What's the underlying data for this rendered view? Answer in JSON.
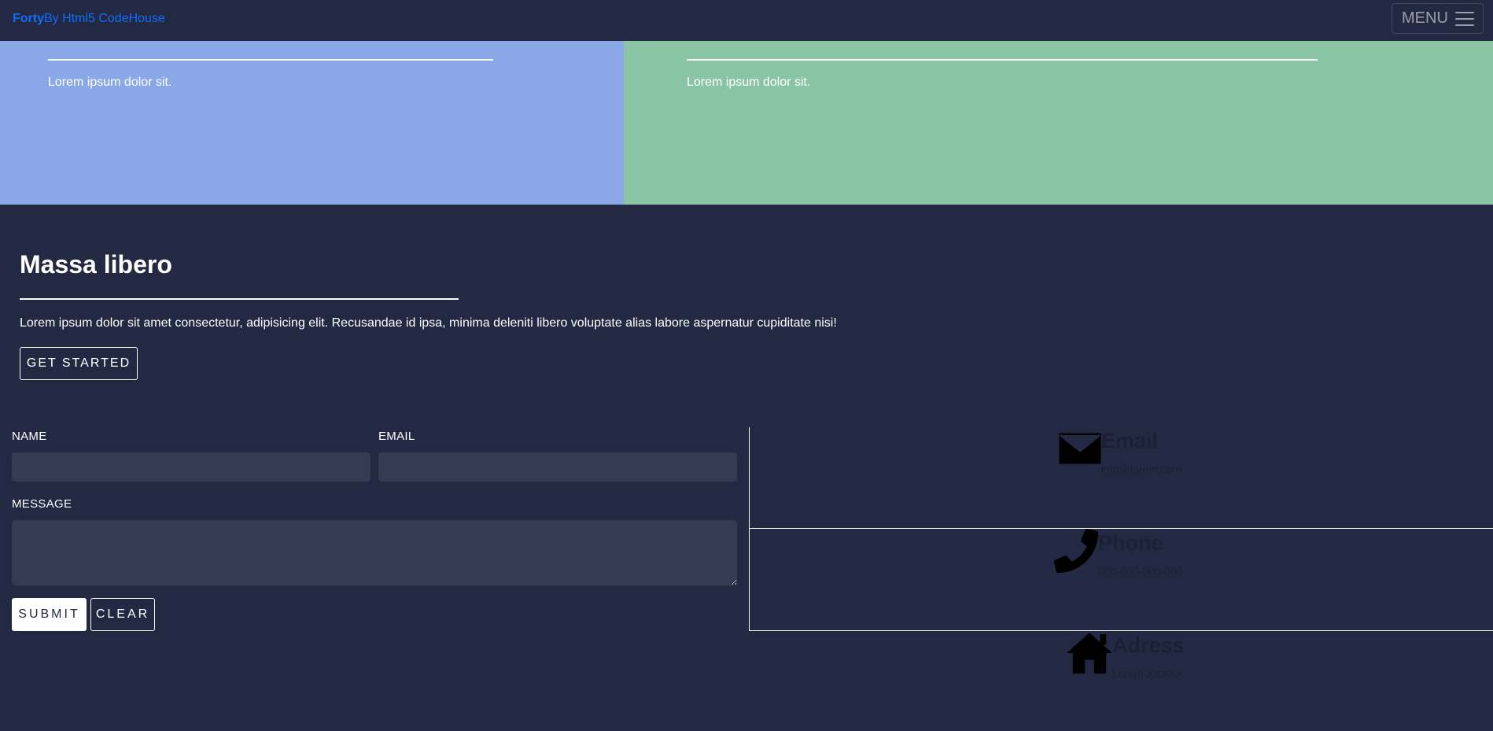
{
  "navbar": {
    "brand_bold": "Forty",
    "brand_rest": "By Html5 CodeHouse",
    "menu_label": "MENU"
  },
  "tiles": [
    {
      "text": "Lorem ipsum dolor sit.",
      "color": "#8aa7e8"
    },
    {
      "text": "Lorem ipsum dolor sit.",
      "color": "#89c4a4"
    }
  ],
  "banner": {
    "heading": "Massa libero",
    "text": "Lorem ipsum dolor sit amet consectetur, adipisicing elit. Recusandae id ipsa, minima deleniti libero voluptate alias labore aspernatur cupiditate nisi!",
    "button_label": "GET STARTED"
  },
  "form": {
    "name_label": "NAME",
    "name_value": "",
    "email_label": "EMAIL",
    "email_value": "",
    "message_label": "MESSAGE",
    "message_value": "",
    "submit_label": "SUBMIT",
    "clear_label": "CLEAR"
  },
  "contact": {
    "email": {
      "title": "Email",
      "value": "info@lorem.com",
      "icon": "envelope-icon"
    },
    "phone": {
      "title": "Phone",
      "value": "000-000-000-000",
      "icon": "phone-icon"
    },
    "address": {
      "title": "Adress",
      "value": "Lorem XXXXX",
      "icon": "home-icon"
    }
  },
  "colors": {
    "background": "#242943",
    "input_background": "#363b54",
    "brand_link": "#0d6efd",
    "contact_text": "#1d2035"
  }
}
